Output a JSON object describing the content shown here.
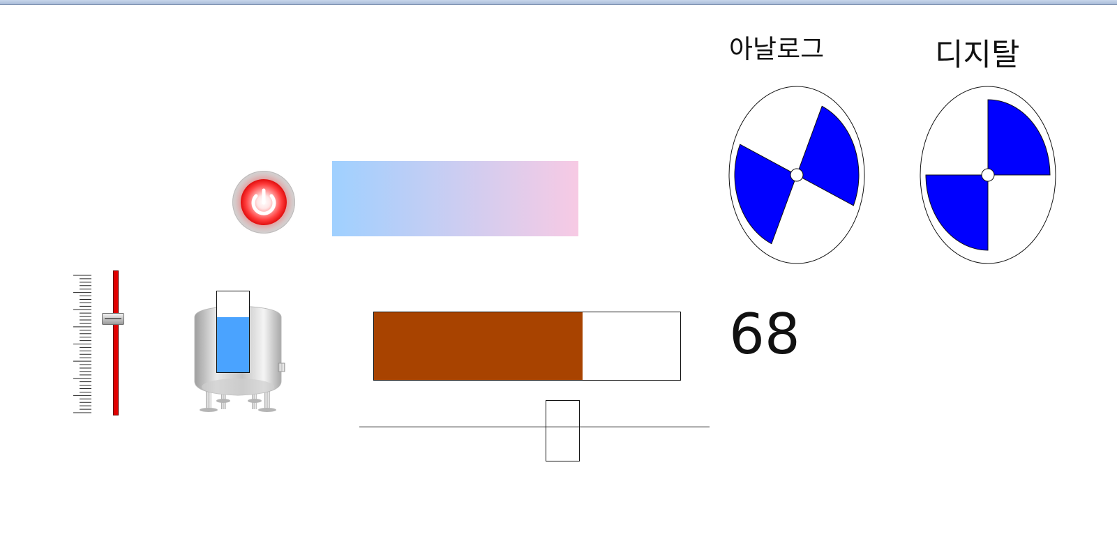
{
  "labels": {
    "analog": "아날로그",
    "digital": "디지탈"
  },
  "value": {
    "display": "68"
  },
  "vertical_slider": {
    "level_fraction": 0.33
  },
  "tank": {
    "level_percent": 68,
    "fill_color": "#4aa3ff"
  },
  "progress": {
    "percent": 68,
    "fill_color": "#a84300"
  },
  "horizontal_slider": {
    "value_percent": 68
  },
  "gradient": {
    "start_color": "#9fd0ff",
    "end_color": "#f7cae4"
  },
  "fans": {
    "blade_color": "#0000ff",
    "analog_rotation_deg": 24,
    "digital_rotation_deg": 0
  },
  "icons": {
    "power": "power-icon",
    "tank": "tank-icon",
    "fan_analog": "fan-icon",
    "fan_digital": "fan-icon"
  }
}
